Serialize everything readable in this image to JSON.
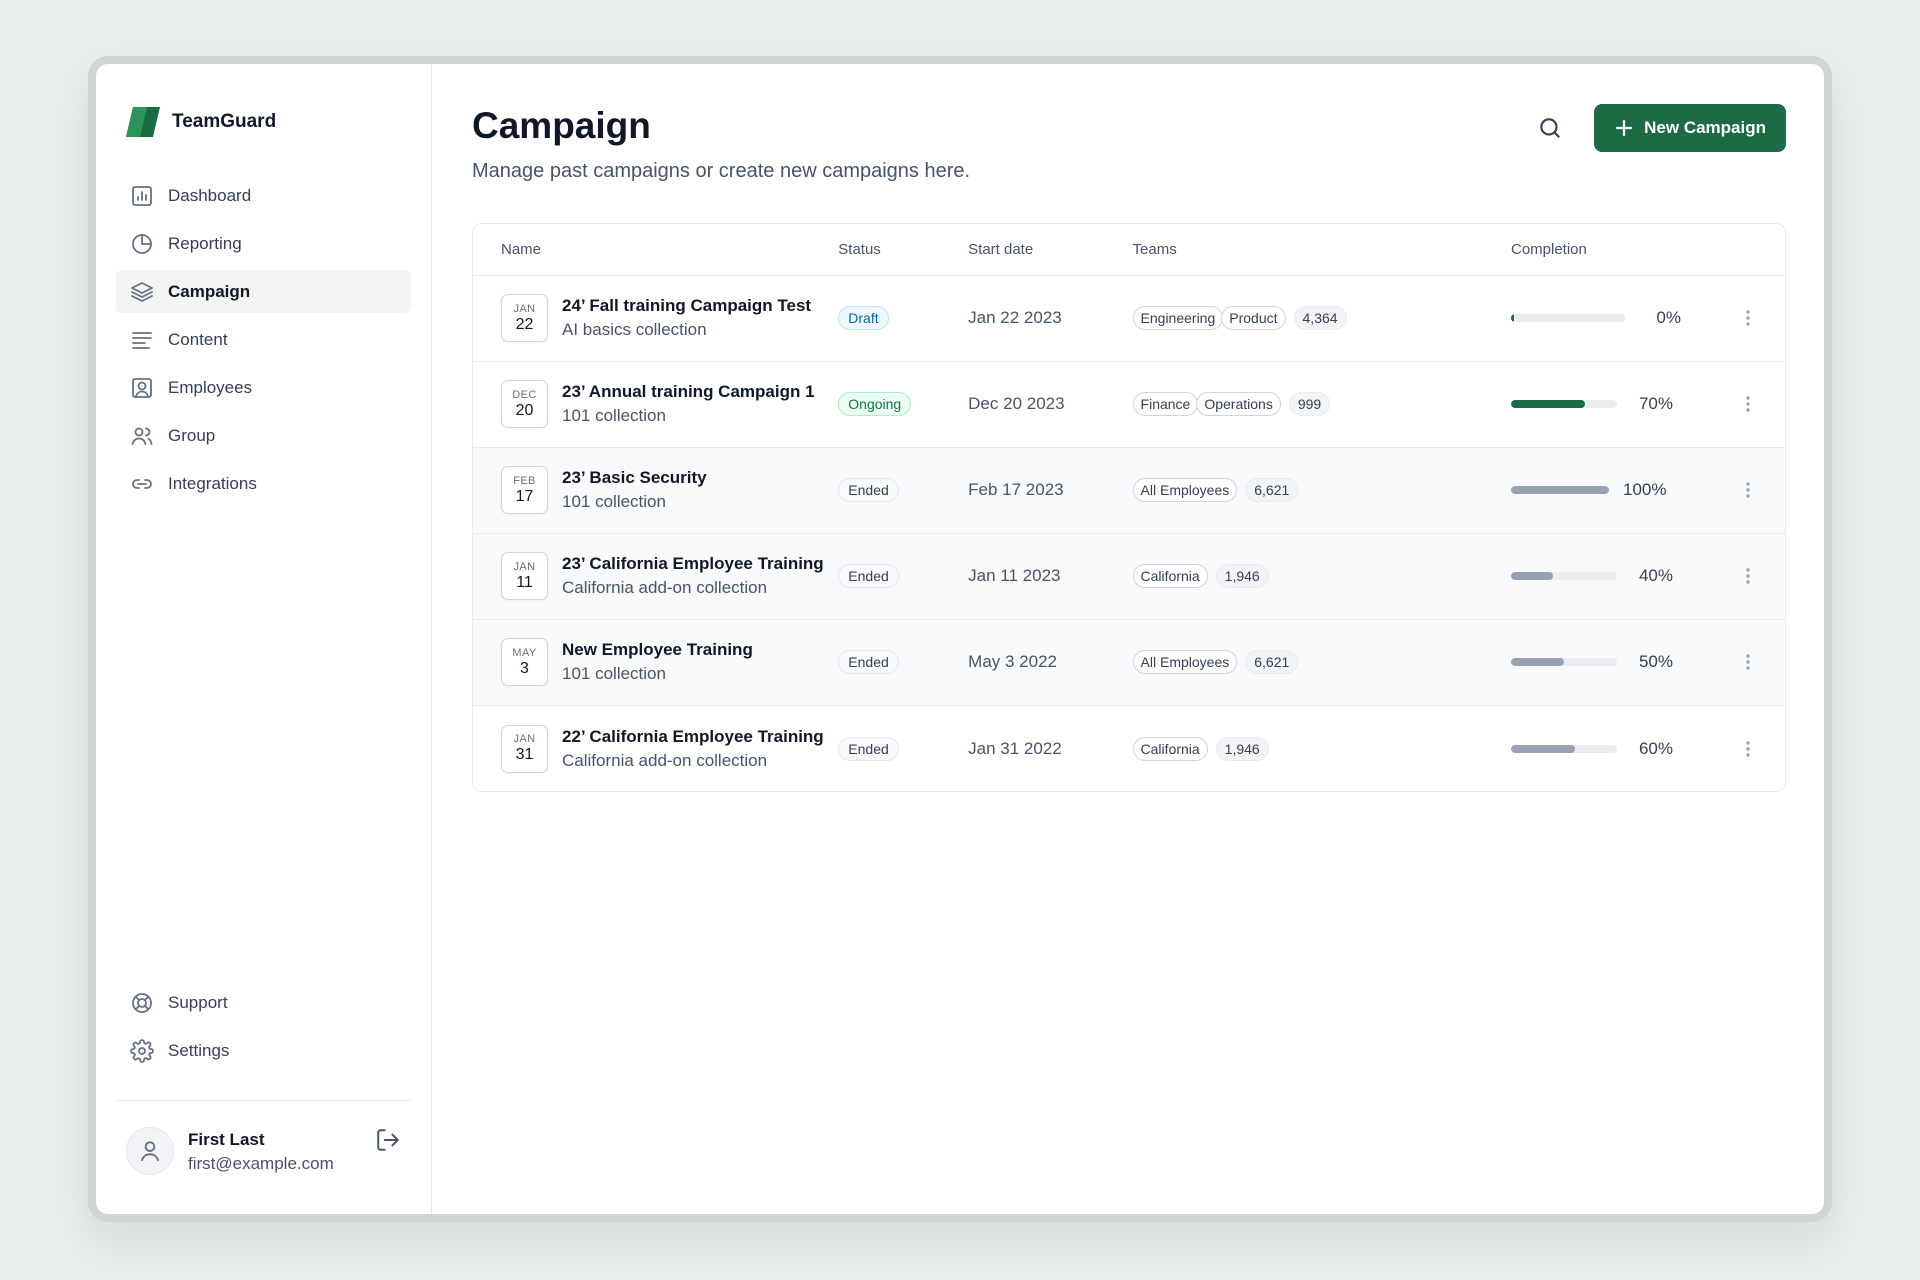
{
  "brand": {
    "name": "TeamGuard",
    "accent": "#1c6b44"
  },
  "sidebar": {
    "items": [
      {
        "label": "Dashboard",
        "icon": "bar-chart-square-icon",
        "active": false
      },
      {
        "label": "Reporting",
        "icon": "pie-chart-icon",
        "active": false
      },
      {
        "label": "Campaign",
        "icon": "layers-icon",
        "active": true
      },
      {
        "label": "Content",
        "icon": "align-left-icon",
        "active": false
      },
      {
        "label": "Employees",
        "icon": "user-square-icon",
        "active": false
      },
      {
        "label": "Group",
        "icon": "users-icon",
        "active": false
      },
      {
        "label": "Integrations",
        "icon": "link-icon",
        "active": false
      }
    ],
    "bottom_items": [
      {
        "label": "Support",
        "icon": "life-buoy-icon"
      },
      {
        "label": "Settings",
        "icon": "gear-icon"
      }
    ],
    "user": {
      "name": "First Last",
      "email": "first@example.com"
    }
  },
  "main": {
    "title": "Campaign",
    "subtitle": "Manage past campaigns or create new campaigns here.",
    "new_button_label": "New Campaign",
    "table": {
      "columns": [
        "Name",
        "Status",
        "Start date",
        "Teams",
        "Completion"
      ],
      "rows": [
        {
          "month": "JAN",
          "day": "22",
          "title": "24’ Fall training Campaign Test",
          "collection": "AI basics collection",
          "status": "Draft",
          "start_date": "Jan 22 2023",
          "teams": [
            "Engineering",
            "Product"
          ],
          "team_count": "4,364",
          "completion": 0,
          "completion_label": "0%"
        },
        {
          "month": "DEC",
          "day": "20",
          "title": "23’ Annual training Campaign 1",
          "collection": "101 collection",
          "status": "Ongoing",
          "start_date": "Dec 20 2023",
          "teams": [
            "Finance",
            "Operations"
          ],
          "team_count": "999",
          "completion": 70,
          "completion_label": "70%"
        },
        {
          "month": "FEB",
          "day": "17",
          "title": "23’ Basic Security",
          "collection": "101 collection",
          "status": "Ended",
          "start_date": "Feb 17 2023",
          "teams": [
            "All Employees"
          ],
          "team_count": "6,621",
          "completion": 100,
          "completion_label": "100%"
        },
        {
          "month": "JAN",
          "day": "11",
          "title": "23’ California Employee Training",
          "collection": "California add-on collection",
          "status": "Ended",
          "start_date": "Jan 11 2023",
          "teams": [
            "California"
          ],
          "team_count": "1,946",
          "completion": 40,
          "completion_label": "40%"
        },
        {
          "month": "MAY",
          "day": "3",
          "title": "New Employee Training",
          "collection": "101 collection",
          "status": "Ended",
          "start_date": "May 3 2022",
          "teams": [
            "All Employees"
          ],
          "team_count": "6,621",
          "completion": 50,
          "completion_label": "50%"
        },
        {
          "month": "JAN",
          "day": "31",
          "title": "22’ California Employee Training",
          "collection": "California add-on collection",
          "status": "Ended",
          "start_date": "Jan 31 2022",
          "teams": [
            "California"
          ],
          "team_count": "1,946",
          "completion": 60,
          "completion_label": "60%"
        }
      ]
    }
  }
}
